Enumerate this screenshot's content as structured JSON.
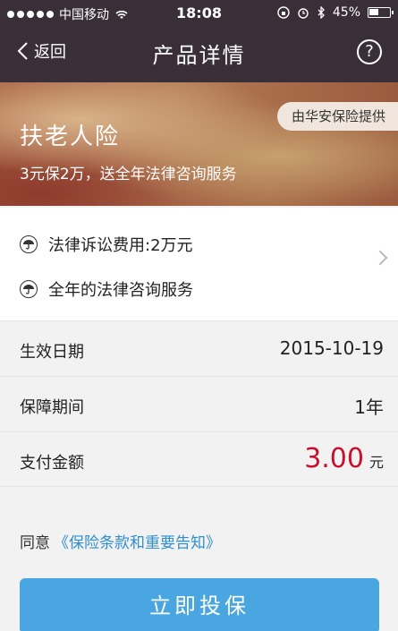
{
  "status": {
    "carrier": "中国移动",
    "time": "18:08",
    "battery": "45%"
  },
  "nav": {
    "back_label": "返回",
    "title": "产品详情",
    "help_icon": "?"
  },
  "banner": {
    "provider": "由华安保险提供",
    "name": "扶老人险",
    "desc": "3元保2万，送全年法律咨询服务"
  },
  "coverage": [
    "法律诉讼费用:2万元",
    "全年的法律咨询服务"
  ],
  "info": {
    "effective_label": "生效日期",
    "effective_value": "2015-10-19",
    "period_label": "保障期间",
    "period_value": "1年",
    "payment_label": "支付金额",
    "payment_value": "3.00",
    "payment_unit": "元"
  },
  "agree": {
    "prefix": "同意",
    "link": "《保险条款和重要告知》"
  },
  "cta": {
    "label": "立即投保"
  },
  "colors": {
    "accent": "#4aa6e0",
    "price": "#c8102e",
    "link": "#2f8fd0"
  }
}
